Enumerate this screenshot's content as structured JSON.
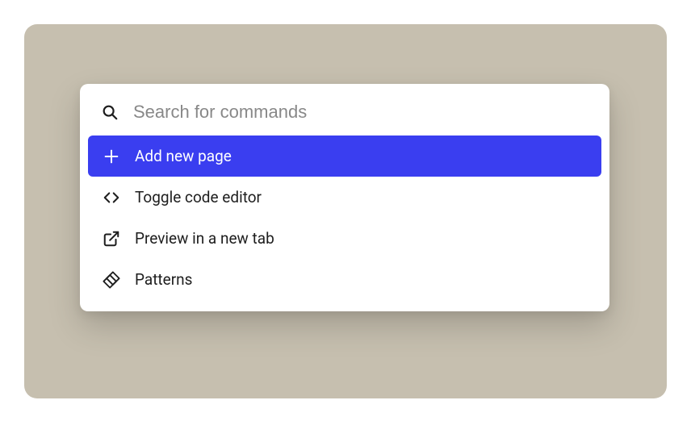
{
  "search": {
    "placeholder": "Search for commands"
  },
  "commands": [
    {
      "label": "Add new page",
      "icon": "plus-icon",
      "selected": true
    },
    {
      "label": "Toggle code editor",
      "icon": "code-icon",
      "selected": false
    },
    {
      "label": "Preview in a new tab",
      "icon": "external-link-icon",
      "selected": false
    },
    {
      "label": "Patterns",
      "icon": "patterns-icon",
      "selected": false
    }
  ],
  "colors": {
    "accent": "#3a3ef0",
    "card_bg": "#c6bfaf"
  }
}
